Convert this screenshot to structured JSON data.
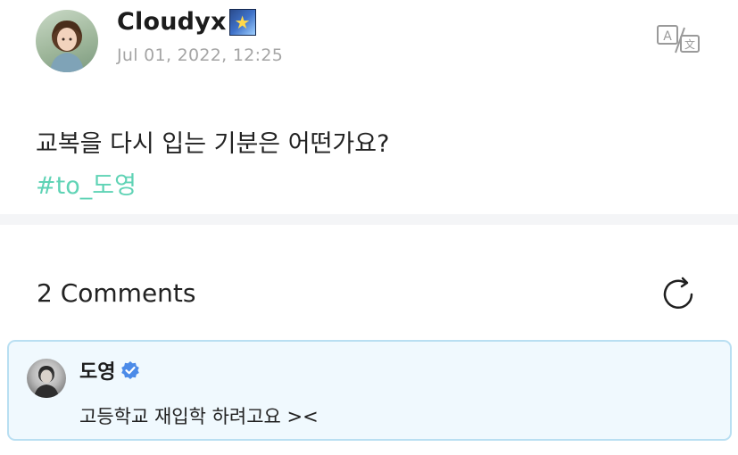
{
  "post": {
    "username": "Cloudyx",
    "badge_icon": "shooting-star-icon",
    "timestamp": "Jul 01, 2022, 12:25",
    "text": "교복을 다시 입는 기분은 어떤가요?",
    "hashtag": "#to_도영",
    "translate_icon": "translate-icon"
  },
  "comments": {
    "header": "2 Comments",
    "refresh_icon": "refresh-icon",
    "items": [
      {
        "author": "도영",
        "verified": true,
        "text": "고등학교 재입학 하려고요 ><"
      }
    ]
  },
  "colors": {
    "hashtag": "#5fd3b5",
    "card_background": "#f0f9fe",
    "card_border": "#b9dff2",
    "verified": "#4b8be8",
    "timestamp": "#a5a5a5"
  }
}
